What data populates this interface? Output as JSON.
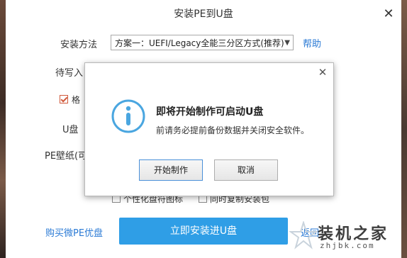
{
  "window": {
    "title": "安装PE到U盘",
    "close_glyph": "✕"
  },
  "form": {
    "install_method_label": "安装方法",
    "install_method_value": "方案一：UEFI/Legacy全能三分区方式(推荐)",
    "help_link": "帮助",
    "target_label_partial": "待写入",
    "format_label_partial": "格",
    "usb_label_partial": "U盘",
    "wallpaper_label_partial": "PE壁纸(可",
    "format_checked": true
  },
  "options": {
    "personalize_icons": "个性化盘符图标",
    "copy_installer": "同时复制安装包"
  },
  "footer": {
    "buy_link": "购买微PE优盘",
    "install_button": "立即安装进U盘",
    "back_link_partial": "返回"
  },
  "watermark": {
    "brand": "装机之家",
    "url": "zhjbk.com"
  },
  "dialog": {
    "title": "即将开始制作可启动U盘",
    "message": "前请务必提前备份数据并关闭安全软件。",
    "start_button": "开始制作",
    "cancel_button": "取消",
    "close_glyph": "✕"
  },
  "colors": {
    "accent": "#2f9ee6",
    "link": "#2a7ad5",
    "info_icon": "#4aa6e0"
  }
}
